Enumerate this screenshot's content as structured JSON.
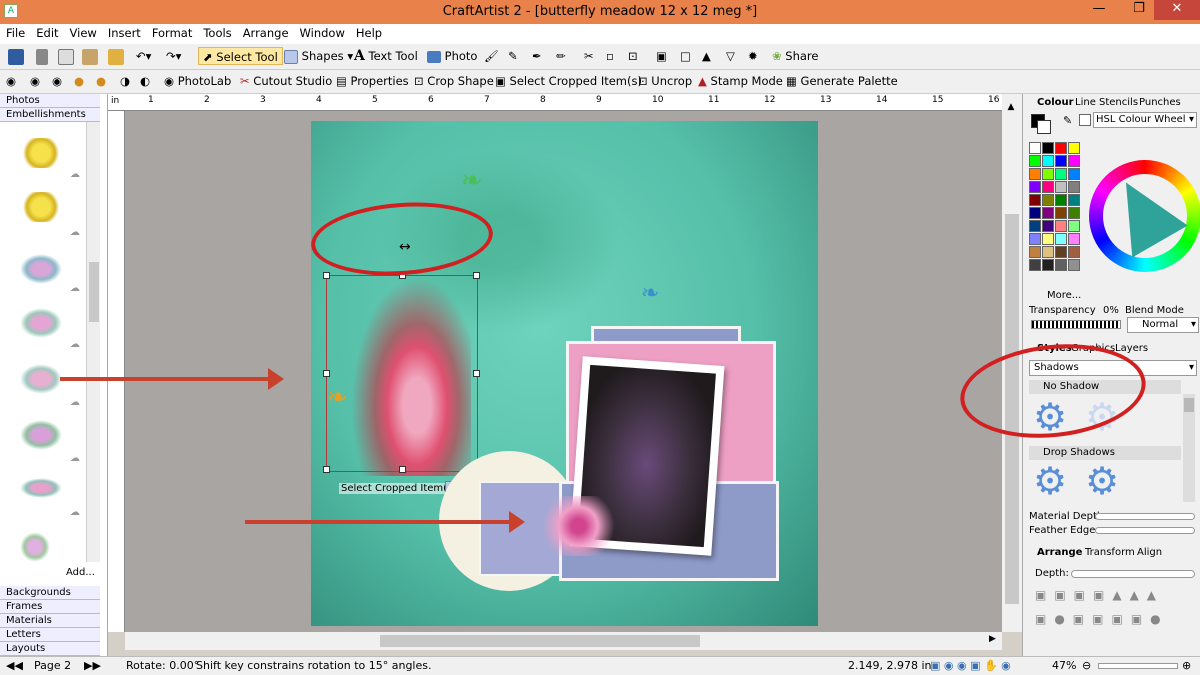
{
  "window": {
    "title": "CraftArtist 2 - [butterfly meadow 12 x 12 meg *]"
  },
  "menu": [
    "File",
    "Edit",
    "View",
    "Insert",
    "Format",
    "Tools",
    "Arrange",
    "Window",
    "Help"
  ],
  "toolbar1": {
    "select_tool": "Select Tool",
    "shapes": "Shapes",
    "text_tool": "Text Tool",
    "photo": "Photo",
    "share": "Share"
  },
  "toolbar2": {
    "photolab": "PhotoLab",
    "cutout": "Cutout Studio",
    "properties": "Properties",
    "crop_shape": "Crop Shape",
    "select_cropped": "Select Cropped Item(s)",
    "uncrop": "Uncrop",
    "stamp_mode": "Stamp Mode",
    "generate_palette": "Generate Palette"
  },
  "left_panel": {
    "tabs_top": [
      "Photos",
      "Embellishments"
    ],
    "add_label": "Add...",
    "tabs_bottom": [
      "Backgrounds",
      "Frames",
      "Materials",
      "Letters",
      "Layouts"
    ]
  },
  "canvas": {
    "selection_tooltip": "Select Cropped Item(s)",
    "ruler_unit": "in",
    "ruler_numbers": [
      "1",
      "2",
      "3",
      "4",
      "5",
      "6",
      "7",
      "8",
      "9",
      "10",
      "11",
      "12",
      "13",
      "14",
      "15",
      "16"
    ]
  },
  "right_panel": {
    "colour_tabs": [
      "Colour",
      "Line",
      "Stencils",
      "Punches"
    ],
    "colour_mode": "HSL Colour Wheel",
    "more": "More...",
    "transparency_label": "Transparency",
    "transparency_value": "0%",
    "blend_mode_label": "Blend Mode",
    "blend_mode_value": "Normal",
    "styles_tabs": [
      "Styles",
      "Graphics",
      "Layers"
    ],
    "styles_category": "Shadows",
    "group_no_shadow": "No Shadow",
    "group_drop_shadows": "Drop Shadows",
    "material_depth": "Material Depth",
    "feather_edge": "Feather Edge",
    "arrange_tabs": [
      "Arrange",
      "Transform",
      "Align"
    ],
    "depth_label": "Depth:"
  },
  "status": {
    "page": "Page 2",
    "rotate": "Rotate: 0.00°",
    "hint": "Shift key constrains rotation to 15° angles.",
    "coords": "2.149, 2.978 in",
    "zoom": "47%"
  },
  "palette": [
    "#ffffff",
    "#000000",
    "#ff0000",
    "#ffff00",
    "#00ff00",
    "#00ffff",
    "#0000ff",
    "#ff00ff",
    "#ff8000",
    "#80ff00",
    "#00ff80",
    "#0080ff",
    "#8000ff",
    "#ff0080",
    "#c0c0c0",
    "#808080",
    "#800000",
    "#808000",
    "#008000",
    "#008080",
    "#000080",
    "#800080",
    "#804000",
    "#408000",
    "#004080",
    "#400080",
    "#ff8080",
    "#80ff80",
    "#8080ff",
    "#ffff80",
    "#80ffff",
    "#ff80ff",
    "#c08040",
    "#e0c080",
    "#604020",
    "#a06040",
    "#404040",
    "#202020",
    "#606060",
    "#909090"
  ]
}
